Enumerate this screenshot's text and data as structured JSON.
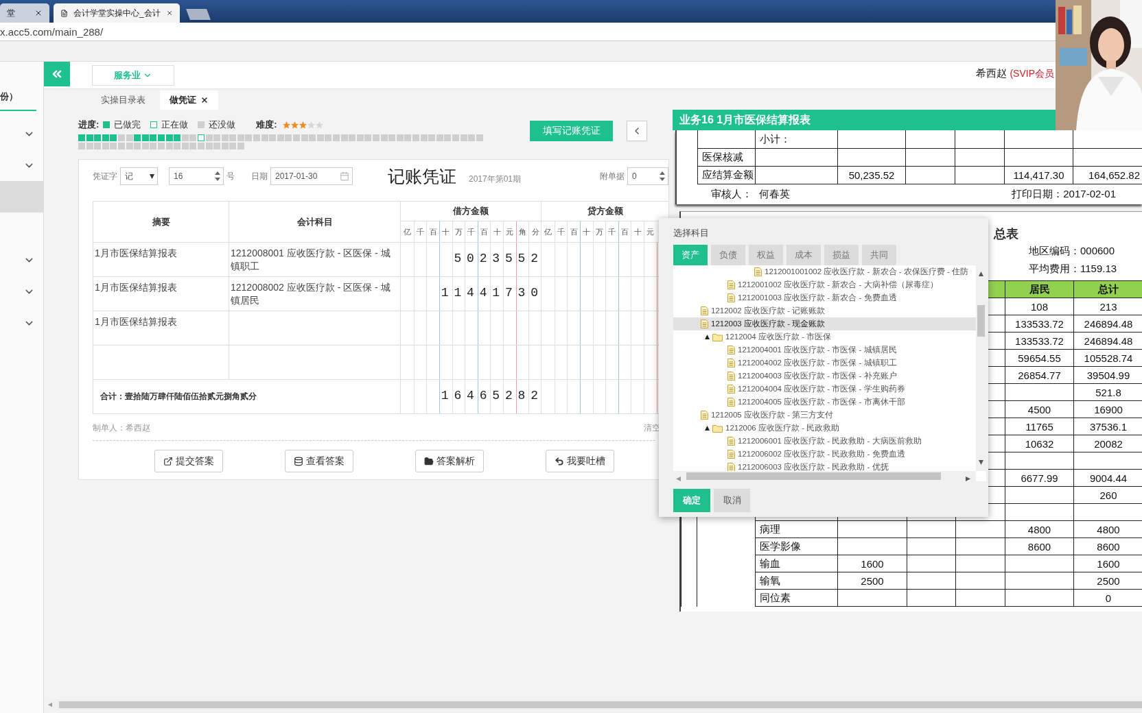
{
  "browser": {
    "tabs": [
      {
        "title": "堂",
        "selected": false
      },
      {
        "title": "会计学堂实操中心_会计",
        "selected": true
      }
    ],
    "url": "x.acc5.com/main_288/"
  },
  "sidebar": {
    "heading": "份）",
    "items": [
      {
        "kind": "group",
        "expanded": false
      },
      {
        "kind": "group",
        "expanded": false
      },
      {
        "kind": "entry",
        "selected": true
      },
      {
        "kind": "entry",
        "selected": false
      },
      {
        "kind": "group",
        "expanded": false
      },
      {
        "kind": "group",
        "expanded": false
      },
      {
        "kind": "group",
        "expanded": false
      }
    ]
  },
  "topbar": {
    "industry": "服务业",
    "user": "希西赵",
    "membership": "(SVIP会员"
  },
  "page_tabs": [
    {
      "label": "实操目录表",
      "selected": false
    },
    {
      "label": "做凭证",
      "selected": true
    }
  ],
  "progress": {
    "label": "进度:",
    "legend": [
      {
        "kind": "done",
        "label": "已做完"
      },
      {
        "kind": "current",
        "label": "正在做"
      },
      {
        "kind": "todo",
        "label": "还没做"
      }
    ],
    "difficulty_label": "难度:",
    "stars": 3,
    "cells": [
      {
        "kind": "done"
      },
      {
        "kind": "done"
      },
      {
        "kind": "done"
      },
      {
        "kind": "done"
      },
      {
        "kind": "done"
      },
      {
        "kind": "todo"
      },
      {
        "kind": "todo"
      },
      {
        "kind": "done"
      },
      {
        "kind": "done"
      },
      {
        "kind": "done"
      },
      {
        "kind": "done"
      },
      {
        "kind": "done"
      },
      {
        "kind": "done"
      },
      {
        "kind": "todo"
      },
      {
        "kind": "todo"
      },
      {
        "kind": "current"
      },
      {
        "kind": "todo"
      },
      {
        "kind": "todo"
      },
      {
        "kind": "todo"
      },
      {
        "kind": "todo"
      },
      {
        "kind": "todo"
      },
      {
        "kind": "todo"
      },
      {
        "kind": "todo"
      },
      {
        "kind": "todo"
      },
      {
        "kind": "todo"
      },
      {
        "kind": "todo"
      },
      {
        "kind": "todo"
      },
      {
        "kind": "todo"
      },
      {
        "kind": "todo"
      },
      {
        "kind": "todo"
      },
      {
        "kind": "todo"
      },
      {
        "kind": "todo"
      },
      {
        "kind": "todo"
      },
      {
        "kind": "todo"
      },
      {
        "kind": "todo"
      },
      {
        "kind": "todo"
      },
      {
        "kind": "todo"
      },
      {
        "kind": "todo"
      },
      {
        "kind": "todo"
      },
      {
        "kind": "todo"
      },
      {
        "kind": "todo"
      },
      {
        "kind": "todo"
      },
      {
        "kind": "todo"
      },
      {
        "kind": "todo"
      },
      {
        "kind": "todo"
      },
      {
        "kind": "todo"
      },
      {
        "kind": "todo"
      },
      {
        "kind": "todo"
      },
      {
        "kind": "todo"
      },
      {
        "kind": "todo"
      },
      {
        "kind": "todo"
      },
      {
        "kind": "todo"
      },
      {
        "kind": "todo"
      },
      {
        "kind": "todo"
      },
      {
        "kind": "todo"
      },
      {
        "kind": "todo"
      },
      {
        "kind": "todo"
      },
      {
        "kind": "todo"
      },
      {
        "kind": "todo"
      },
      {
        "kind": "todo"
      },
      {
        "kind": "todo"
      },
      {
        "kind": "todo"
      },
      {
        "kind": "todo"
      },
      {
        "kind": "todo"
      },
      {
        "kind": "todo"
      },
      {
        "kind": "todo"
      },
      {
        "kind": "todo"
      },
      {
        "kind": "todo"
      },
      {
        "kind": "todo"
      },
      {
        "kind": "todo"
      },
      {
        "kind": "todo"
      },
      {
        "kind": "todo"
      }
    ]
  },
  "fill_button": "填写记账凭证",
  "voucher": {
    "word_label": "凭证字",
    "word": "记",
    "number": "16",
    "number_suffix": "号",
    "date_label": "日期",
    "date": "2017-01-30",
    "title": "记账凭证",
    "period": "2017年第01期",
    "attachments_label": "附单据",
    "attachments": "0",
    "columns": {
      "summary": "摘要",
      "account": "会计科目",
      "debit": "借方金额",
      "credit": "贷方金额"
    },
    "debit_units": [
      "亿",
      "千",
      "百",
      "十",
      "万",
      "千",
      "百",
      "十",
      "元",
      "角",
      "分"
    ],
    "credit_units": [
      "亿",
      "千",
      "百",
      "十",
      "万",
      "千",
      "百",
      "十",
      "元"
    ],
    "entries": [
      {
        "kind": "line",
        "summary": "1月市医保结算报表",
        "account": "1212008001 应收医疗款 - 区医保 - 城镇职工",
        "debit": "5023552"
      },
      {
        "kind": "line",
        "summary": "1月市医保结算报表",
        "account": "1212008002 应收医疗款 - 区医保 - 城镇居民",
        "debit": "11441730"
      },
      {
        "kind": "line",
        "summary": "1月市医保结算报表"
      },
      {
        "kind": "blank"
      }
    ],
    "total": {
      "label": "合计：壹拾陆万肆仟陆佰伍拾贰元捌角贰分",
      "debit": "16465282"
    },
    "maker": "制单人：希西赵",
    "clear": "清空"
  },
  "actions": [
    {
      "kind": "submit",
      "label": "提交答案"
    },
    {
      "kind": "view",
      "label": "查看答案"
    },
    {
      "kind": "analysis",
      "label": "答案解析"
    },
    {
      "kind": "feedback",
      "label": "我要吐槽"
    }
  ],
  "report": {
    "title": "业务16 1月市医保结算报表",
    "summary_rows": [
      {
        "column_2": "小计："
      },
      {
        "column_1": "医保核减"
      },
      {
        "column_1": "应结算金额",
        "column_3": "50,235.52",
        "column_6": "114,417.30",
        "column_7": "164,652.82"
      }
    ],
    "reviewer_label": "审核人：",
    "reviewer": "何春英",
    "print_date": "打印日期：2017-02-01",
    "detail": {
      "title": "总表",
      "region_code": "地区编码：000600",
      "average_cost": "平均费用：1159.13",
      "columns": {
        "resident": "居民",
        "total": "总计"
      },
      "rows": [
        {
          "resident": "108",
          "total": "213"
        },
        {
          "resident": "133533.72",
          "total": "246894.48"
        },
        {
          "resident": "133533.72",
          "total": "246894.48"
        },
        {
          "resident": "59654.55",
          "total": "105528.74"
        },
        {
          "resident": "26854.77",
          "total": "39504.99"
        },
        {
          "total": "521.8"
        },
        {
          "resident": "4500",
          "total": "16900"
        },
        {
          "resident": "11765",
          "total": "37536.1"
        },
        {
          "resident": "10632",
          "total": "20082"
        },
        {},
        {
          "resident": "6677.99",
          "total": "9004.44"
        },
        {
          "total": "260"
        },
        {},
        {
          "name": "病理",
          "resident": "4800",
          "total": "4800"
        },
        {
          "name": "医学影像",
          "resident": "8600",
          "total": "8600"
        },
        {
          "name": "输血",
          "column_4": "1600",
          "total": "1600"
        },
        {
          "name": "输氧",
          "column_4": "2500",
          "total": "2500"
        },
        {
          "name": "同位素",
          "total": "0"
        }
      ]
    }
  },
  "dialog": {
    "title": "选择科目",
    "tabs": [
      {
        "label": "资产",
        "selected": true
      },
      {
        "label": "负债",
        "selected": false
      },
      {
        "label": "权益",
        "selected": false
      },
      {
        "label": "成本",
        "selected": false
      },
      {
        "label": "损益",
        "selected": false
      },
      {
        "label": "共同",
        "selected": false
      }
    ],
    "tree": [
      {
        "children": [
          {
            "children": [
              {
                "children": [
                  {
                    "label": "1212001001002 应收医疗款 - 新农合 - 农保医疗费 - 住防",
                    "selected": false
                  }
                ]
              },
              {
                "label": "1212001002 应收医疗款 - 新农合 - 大病补偿（尿毒症）",
                "selected": false
              },
              {
                "label": "1212001003 应收医疗款 - 新农合 - 免费血透",
                "selected": false
              }
            ]
          },
          {
            "label": "1212002 应收医疗款 - 记账账款",
            "selected": false
          },
          {
            "label": "1212003 应收医疗款 - 现金账款",
            "selected": true
          },
          {
            "label": "1212004 应收医疗款 - 市医保",
            "selected": false,
            "expanded": true,
            "children": [
              {
                "label": "1212004001 应收医疗款 - 市医保 - 城镇居民",
                "selected": false
              },
              {
                "label": "1212004002 应收医疗款 - 市医保 - 城镇职工",
                "selected": false
              },
              {
                "label": "1212004003 应收医疗款 - 市医保 - 补充账户",
                "selected": false
              },
              {
                "label": "1212004004 应收医疗款 - 市医保 - 学生购药券",
                "selected": false
              },
              {
                "label": "1212004005 应收医疗款 - 市医保 - 市离休干部",
                "selected": false
              }
            ]
          },
          {
            "label": "1212005 应收医疗款 - 第三方支付",
            "selected": false
          },
          {
            "label": "1212006 应收医疗款 - 民政救助",
            "selected": false,
            "expanded": true,
            "children": [
              {
                "label": "1212006001 应收医疗款 - 民政救助 - 大病医前救助",
                "selected": false
              },
              {
                "label": "1212006002 应收医疗款 - 民政救助 - 免费血透",
                "selected": false
              },
              {
                "label": "1212006003 应收医疗款 - 民政救助 - 优抚",
                "selected": false
              }
            ]
          }
        ]
      }
    ],
    "ok": "确定",
    "cancel": "取消"
  }
}
